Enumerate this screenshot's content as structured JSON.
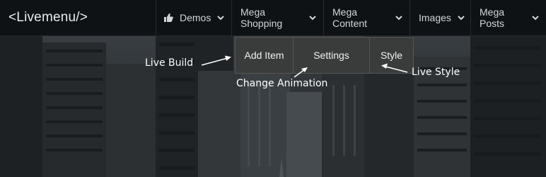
{
  "brand": {
    "label": "<Livemenu/>"
  },
  "menu": {
    "items": [
      {
        "label": "Demos",
        "icon": "thumbs-up-icon"
      },
      {
        "label": "Mega Shopping"
      },
      {
        "label": "Mega Content"
      },
      {
        "label": "Images"
      },
      {
        "label": "Mega Posts"
      }
    ]
  },
  "live_panel": {
    "add_item": "Add Item",
    "settings": "Settings",
    "style": "Style"
  },
  "annotations": {
    "live_build": "Live Build",
    "change_animation": "Change Animation",
    "live_style": "Live Style"
  },
  "colors": {
    "navbar": "#0f1214",
    "panel": "#3a3b3b",
    "annotation_text": "#ffffff"
  }
}
